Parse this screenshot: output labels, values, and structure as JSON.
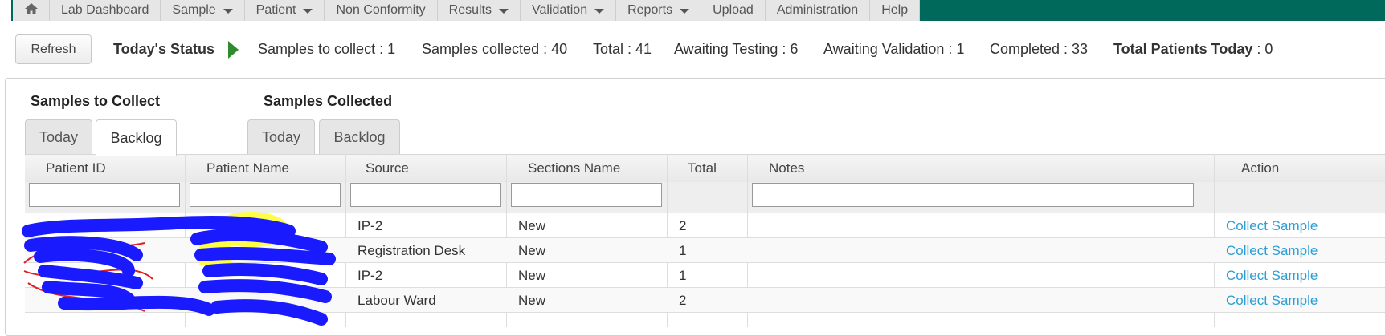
{
  "nav": {
    "home_icon": "home-icon",
    "items": [
      {
        "label": "Lab Dashboard",
        "has_dropdown": false
      },
      {
        "label": "Sample",
        "has_dropdown": true
      },
      {
        "label": "Patient",
        "has_dropdown": true
      },
      {
        "label": "Non Conformity",
        "has_dropdown": false
      },
      {
        "label": "Results",
        "has_dropdown": true
      },
      {
        "label": "Validation",
        "has_dropdown": true
      },
      {
        "label": "Reports",
        "has_dropdown": true
      },
      {
        "label": "Upload",
        "has_dropdown": false
      },
      {
        "label": "Administration",
        "has_dropdown": false
      },
      {
        "label": "Help",
        "has_dropdown": false
      }
    ],
    "bar_color": "#00695c"
  },
  "status": {
    "refresh_label": "Refresh",
    "title": "Today's Status",
    "samples_to_collect": "Samples to collect : 1",
    "samples_collected": "Samples collected : 40",
    "total": "Total : 41",
    "awaiting_testing": "Awaiting Testing : 6",
    "awaiting_validation": "Awaiting Validation : 1",
    "completed": "Completed : 33",
    "total_patients_label": "Total Patients Today",
    "total_patients_value": " : 0"
  },
  "groups": {
    "to_collect": {
      "title": "Samples to Collect",
      "tabs": [
        "Today",
        "Backlog"
      ],
      "active_tab": "Backlog"
    },
    "collected": {
      "title": "Samples Collected",
      "tabs": [
        "Today",
        "Backlog"
      ]
    }
  },
  "table": {
    "columns": [
      "Patient ID",
      "Patient Name",
      "Source",
      "Sections Name",
      "Total",
      "Notes",
      "Action"
    ],
    "rows": [
      {
        "patient_id": "",
        "patient_name": "",
        "source": "IP-2",
        "section": "New",
        "total": "2",
        "notes": "",
        "action": "Collect Sample"
      },
      {
        "patient_id": "",
        "patient_name": "",
        "source": "Registration Desk",
        "section": "New",
        "total": "1",
        "notes": "",
        "action": "Collect Sample"
      },
      {
        "patient_id": "",
        "patient_name": "",
        "source": "IP-2",
        "section": "New",
        "total": "1",
        "notes": "",
        "action": "Collect Sample"
      },
      {
        "patient_id": "",
        "patient_name": "",
        "source": "Labour Ward",
        "section": "New",
        "total": "2",
        "notes": "",
        "action": "Collect Sample"
      }
    ]
  },
  "colors": {
    "link": "#2a9fd6",
    "status_arrow": "#2e8b2e",
    "redaction": "#1a1aff",
    "highlight": "#ffff33"
  }
}
